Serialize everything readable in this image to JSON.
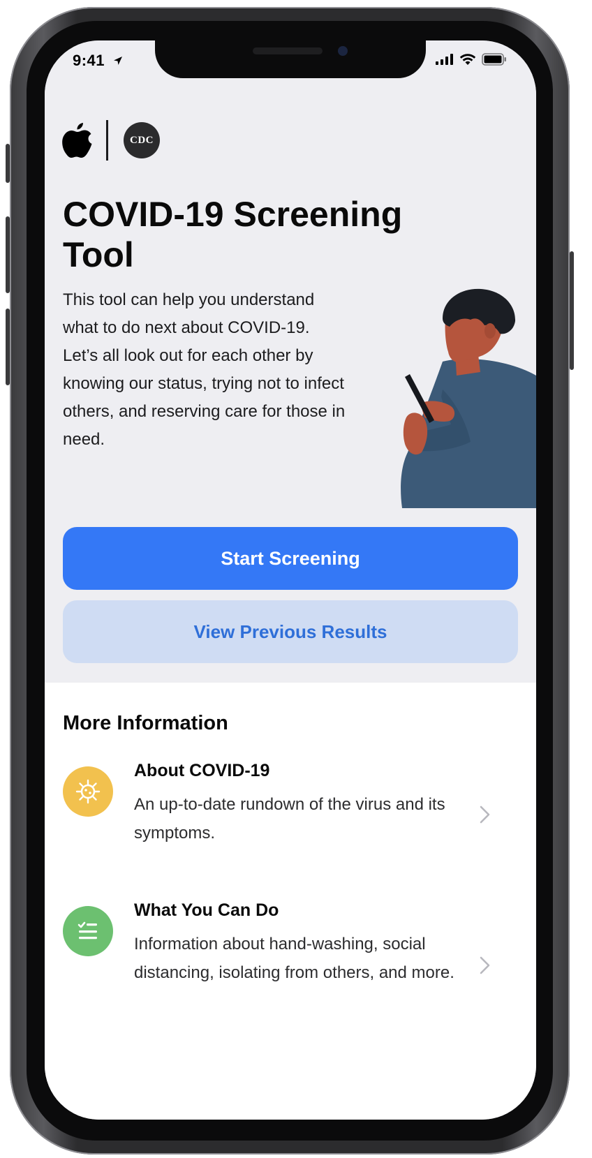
{
  "status_bar": {
    "time": "9:41",
    "location_icon": "location-arrow-icon",
    "signal_icon": "cellular-signal-icon",
    "wifi_icon": "wifi-icon",
    "battery_icon": "battery-icon"
  },
  "logos": {
    "apple_icon": "apple-logo-icon",
    "cdc_text": "CDC"
  },
  "hero": {
    "title": "COVID-19 Screening Tool",
    "description": "This tool can help you understand what to do next about COVID-19. Let’s all look out for each other by knowing our status, trying not to infect others, and reserving care for those in need."
  },
  "actions": {
    "primary_label": "Start Screening",
    "secondary_label": "View Previous Results"
  },
  "more_info": {
    "title": "More Information",
    "items": [
      {
        "title": "About COVID-19",
        "description": "An up-to-date rundown of the virus and its symptoms.",
        "icon": "virus-icon",
        "icon_color": "#f2c14e"
      },
      {
        "title": "What You Can Do",
        "description": "Information about hand-washing, social distancing, isolating from others, and more.",
        "icon": "checklist-icon",
        "icon_color": "#6cc070"
      }
    ]
  },
  "colors": {
    "primary_button": "#3478f6",
    "secondary_button_bg": "#cfdcf3",
    "secondary_button_text": "#2f6fd8",
    "top_background": "#eeeef2"
  }
}
